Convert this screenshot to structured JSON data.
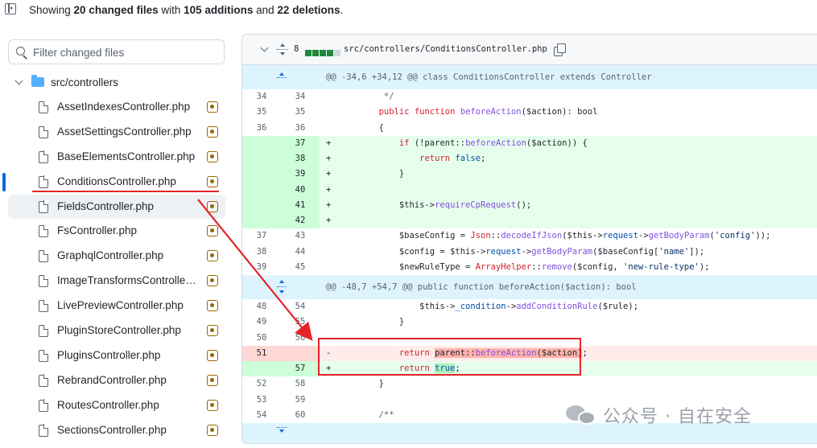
{
  "summary": {
    "prefix": "Showing ",
    "files": "20 changed files",
    "mid1": " with ",
    "additions": "105 additions",
    "mid2": " and ",
    "deletions": "22 deletions",
    "suffix": "."
  },
  "filter": {
    "placeholder": "Filter changed files"
  },
  "tree": {
    "folder": "src/controllers",
    "files": [
      "AssetIndexesController.php",
      "AssetSettingsController.php",
      "BaseElementsController.php",
      "ConditionsController.php",
      "FieldsController.php",
      "FsController.php",
      "GraphqlController.php",
      "ImageTransformsController....",
      "LivePreviewController.php",
      "PluginStoreController.php",
      "PluginsController.php",
      "RebrandController.php",
      "RoutesController.php",
      "SectionsController.php"
    ],
    "selected_file": "ConditionsController.php"
  },
  "diff": {
    "change_count": "8",
    "file_path": "src/controllers/ConditionsController.php",
    "hunks": [
      "@@ -34,6 +34,12 @@ class ConditionsController extends Controller",
      "@@ -48,7 +54,7 @@ public function beforeAction($action): bool"
    ],
    "lines": [
      {
        "o": "34",
        "n": "34",
        "s": "",
        "t": "ctx",
        "code": "         */"
      },
      {
        "o": "35",
        "n": "35",
        "s": "",
        "t": "ctx",
        "code": "        public function beforeAction($action): bool"
      },
      {
        "o": "36",
        "n": "36",
        "s": "",
        "t": "ctx",
        "code": "        {"
      },
      {
        "o": "",
        "n": "37",
        "s": "+",
        "t": "add",
        "code": "            if (!parent::beforeAction($action)) {"
      },
      {
        "o": "",
        "n": "38",
        "s": "+",
        "t": "add",
        "code": "                return false;"
      },
      {
        "o": "",
        "n": "39",
        "s": "+",
        "t": "add",
        "code": "            }"
      },
      {
        "o": "",
        "n": "40",
        "s": "+",
        "t": "add",
        "code": ""
      },
      {
        "o": "",
        "n": "41",
        "s": "+",
        "t": "add",
        "code": "            $this->requireCpRequest();"
      },
      {
        "o": "",
        "n": "42",
        "s": "+",
        "t": "add",
        "code": ""
      },
      {
        "o": "37",
        "n": "43",
        "s": "",
        "t": "ctx",
        "code": "            $baseConfig = Json::decodeIfJson($this->request->getBodyParam('config'));"
      },
      {
        "o": "38",
        "n": "44",
        "s": "",
        "t": "ctx",
        "code": "            $config = $this->request->getBodyParam($baseConfig['name']);"
      },
      {
        "o": "39",
        "n": "45",
        "s": "",
        "t": "ctx",
        "code": "            $newRuleType = ArrayHelper::remove($config, 'new-rule-type');"
      },
      {
        "o": "48",
        "n": "54",
        "s": "",
        "t": "ctx",
        "code": "                $this->_condition->addConditionRule($rule);"
      },
      {
        "o": "49",
        "n": "55",
        "s": "",
        "t": "ctx",
        "code": "            }"
      },
      {
        "o": "50",
        "n": "56",
        "s": "",
        "t": "ctx",
        "code": ""
      },
      {
        "o": "51",
        "n": "",
        "s": "-",
        "t": "del",
        "code": "            return parent::beforeAction($action);"
      },
      {
        "o": "",
        "n": "57",
        "s": "+",
        "t": "add",
        "code": "            return true;"
      },
      {
        "o": "52",
        "n": "58",
        "s": "",
        "t": "ctx",
        "code": "        }"
      },
      {
        "o": "53",
        "n": "59",
        "s": "",
        "t": "ctx",
        "code": ""
      },
      {
        "o": "54",
        "n": "60",
        "s": "",
        "t": "ctx",
        "code": "        /**"
      }
    ]
  },
  "watermark": {
    "text": "公众号 · 自在安全"
  },
  "colors": {
    "addition": "#1f883d",
    "deletion": "#cf222e",
    "hunk": "#ddf4ff",
    "annotation": "#e5242a"
  },
  "icons": [
    "sidebar-toggle-icon",
    "search-icon",
    "chevron-down-icon",
    "folder-icon",
    "file-icon",
    "file-modified-icon",
    "expand-icon",
    "copy-icon",
    "wechat-icon"
  ]
}
